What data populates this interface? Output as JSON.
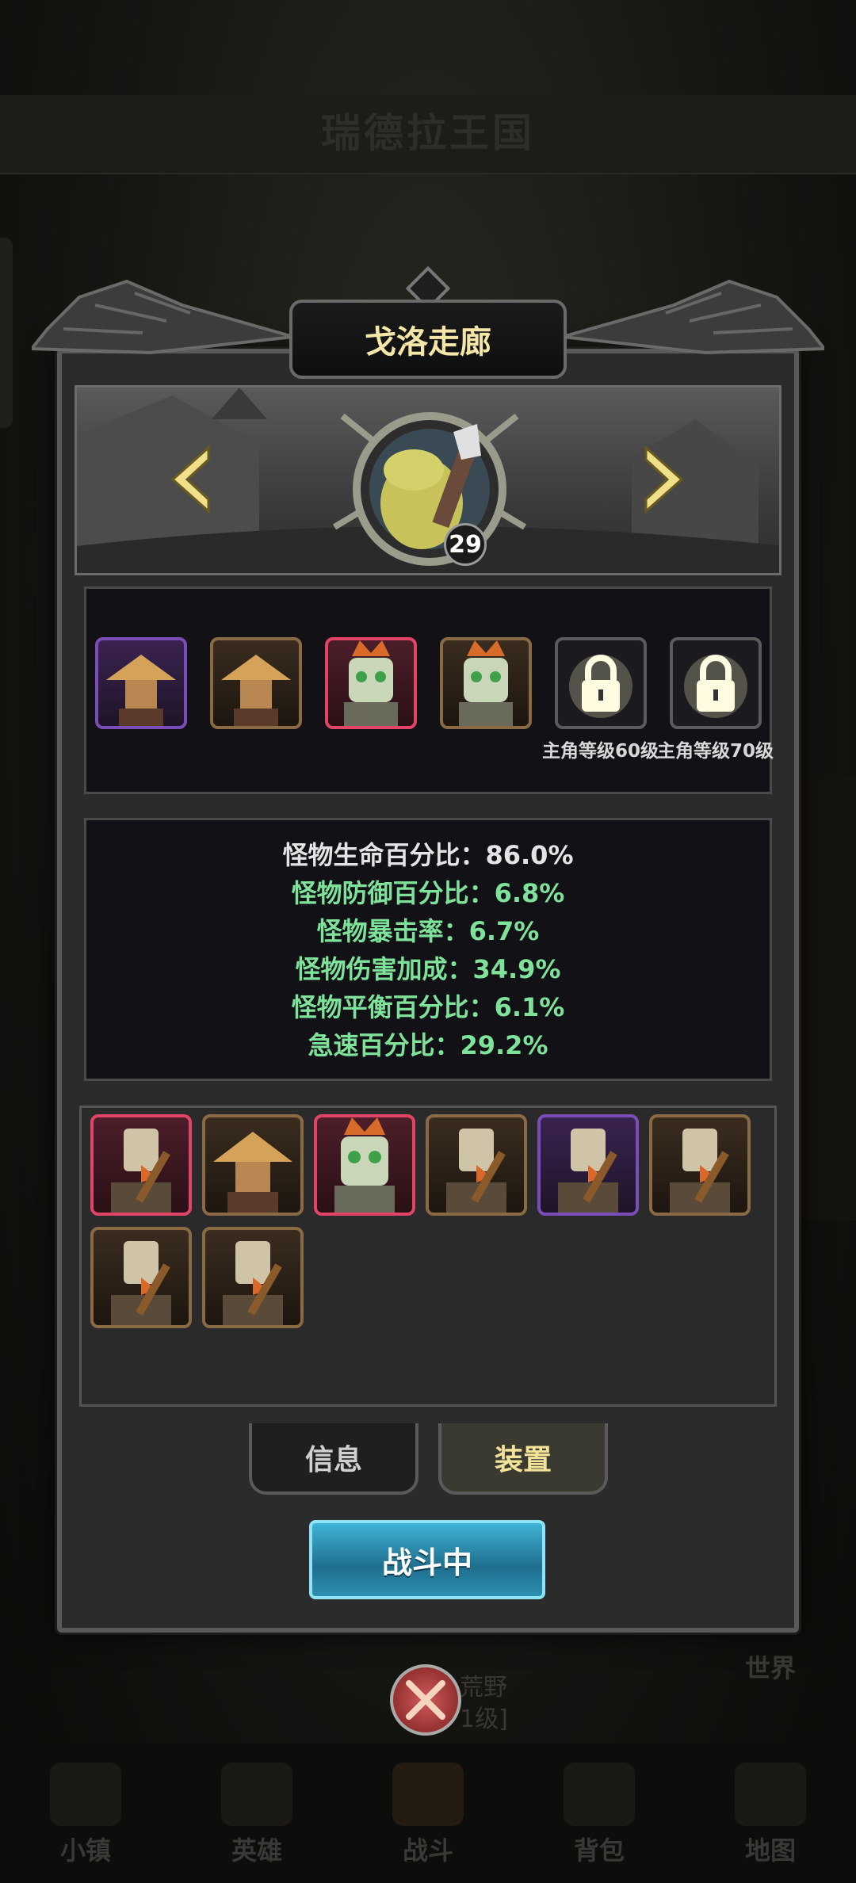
{
  "background": {
    "kingdom_title": "瑞德拉王国",
    "world_label": "世界",
    "wild_label_line1": "荒野",
    "wild_label_line2": "1级]"
  },
  "bottom_nav": [
    {
      "label": "小镇",
      "icon": "town-icon"
    },
    {
      "label": "英雄",
      "icon": "hero-icon"
    },
    {
      "label": "战斗",
      "icon": "battle-icon"
    },
    {
      "label": "背包",
      "icon": "backpack-icon"
    },
    {
      "label": "地图",
      "icon": "map-icon"
    }
  ],
  "dialog": {
    "title": "戈洛走廊",
    "boss": {
      "name_icon": "toad-boss-portrait",
      "level": "29"
    },
    "wave_slots": [
      {
        "monster": "scarecrow",
        "rarity": "purple"
      },
      {
        "monster": "scarecrow",
        "rarity": "brown"
      },
      {
        "monster": "tiki-skull",
        "rarity": "red"
      },
      {
        "monster": "tiki-skull",
        "rarity": "brown"
      },
      {
        "monster": "locked",
        "rarity": "locked",
        "unlock_text": "主角等级60级"
      },
      {
        "monster": "locked",
        "rarity": "locked",
        "unlock_text": "主角等级70级"
      }
    ],
    "stats": [
      {
        "text": "怪物生命百分比：86.0%",
        "color": "white"
      },
      {
        "text": "怪物防御百分比：6.8%",
        "color": "green"
      },
      {
        "text": "怪物暴击率：6.7%",
        "color": "green"
      },
      {
        "text": "怪物伤害加成：34.9%",
        "color": "green"
      },
      {
        "text": "怪物平衡百分比：6.1%",
        "color": "green"
      },
      {
        "text": "急速百分比：29.2%",
        "color": "green"
      }
    ],
    "units": [
      {
        "monster": "crossbow-beak",
        "rarity": "red"
      },
      {
        "monster": "scarecrow",
        "rarity": "brown"
      },
      {
        "monster": "tiki-skull",
        "rarity": "red"
      },
      {
        "monster": "crossbow-beak",
        "rarity": "brown"
      },
      {
        "monster": "crossbow-beak",
        "rarity": "purple"
      },
      {
        "monster": "crossbow-beak",
        "rarity": "brown"
      },
      {
        "monster": "crossbow-beak",
        "rarity": "brown"
      },
      {
        "monster": "crossbow-beak",
        "rarity": "brown"
      }
    ],
    "tabs": {
      "info": "信息",
      "equip": "装置"
    },
    "battle_button": "战斗中"
  },
  "colors": {
    "title_text": "#f3e6a8",
    "stat_green": "#7ee29a",
    "rarity_purple": "#7a4db8",
    "rarity_brown": "#8a6a45",
    "rarity_red": "#e24467",
    "battle_button": "#2d8fb0"
  }
}
